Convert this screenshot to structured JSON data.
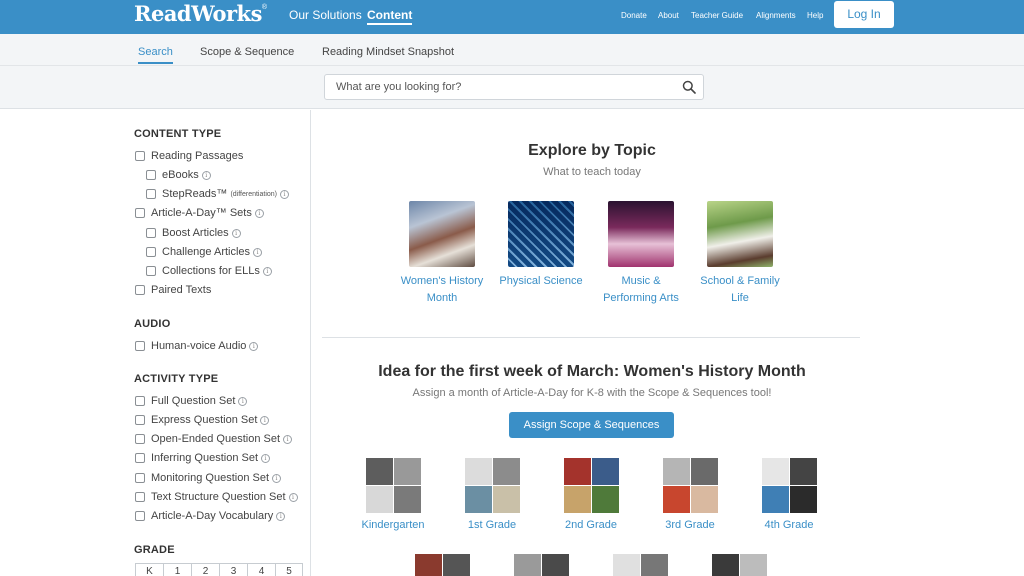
{
  "brand": {
    "name": "ReadWorks",
    "mark": "®"
  },
  "header": {
    "nav": [
      "Our Solutions",
      "Content"
    ],
    "utility": [
      "Donate",
      "About",
      "Teacher Guide",
      "Alignments",
      "Help"
    ],
    "login_label": "Log In"
  },
  "subnav": {
    "tabs": [
      "Search",
      "Scope & Sequence",
      "Reading Mindset Snapshot"
    ]
  },
  "search": {
    "placeholder": "What are you looking for?"
  },
  "sidebar": {
    "content_type": {
      "title": "CONTENT TYPE",
      "items": [
        "Reading Passages",
        "eBooks",
        "StepReads™",
        "Article-A-Day™ Sets",
        "Boost Articles",
        "Challenge Articles",
        "Collections for ELLs",
        "Paired Texts"
      ],
      "stepreads_note": "(differentiation)"
    },
    "audio": {
      "title": "AUDIO",
      "items": [
        "Human-voice Audio"
      ]
    },
    "activity_type": {
      "title": "ACTIVITY TYPE",
      "items": [
        "Full Question Set",
        "Express Question Set",
        "Open-Ended Question Set",
        "Inferring Question Set",
        "Monitoring Question Set",
        "Text Structure Question Set",
        "Article-A-Day Vocabulary"
      ]
    },
    "grade": {
      "title": "GRADE",
      "options": [
        "K",
        "1",
        "2",
        "3",
        "4",
        "5"
      ]
    }
  },
  "explore": {
    "title": "Explore by Topic",
    "subtitle": "What to teach today",
    "topics": [
      {
        "line1": "Women's History",
        "line2": "Month"
      },
      {
        "line1": "Physical Science",
        "line2": ""
      },
      {
        "line1": "Music &",
        "line2": "Performing Arts"
      },
      {
        "line1": "School & Family",
        "line2": "Life"
      }
    ]
  },
  "idea": {
    "title": "Idea for the first week of March: Women's History Month",
    "subtitle": "Assign a month of Article-A-Day for K-8 with the Scope & Sequences tool!",
    "button_label": "Assign Scope & Sequences",
    "grades": [
      "Kindergarten",
      "1st Grade",
      "2nd Grade",
      "3rd Grade",
      "4th Grade"
    ]
  },
  "colors": {
    "brand": "#3a8fc7",
    "link": "#3a8fc7"
  }
}
